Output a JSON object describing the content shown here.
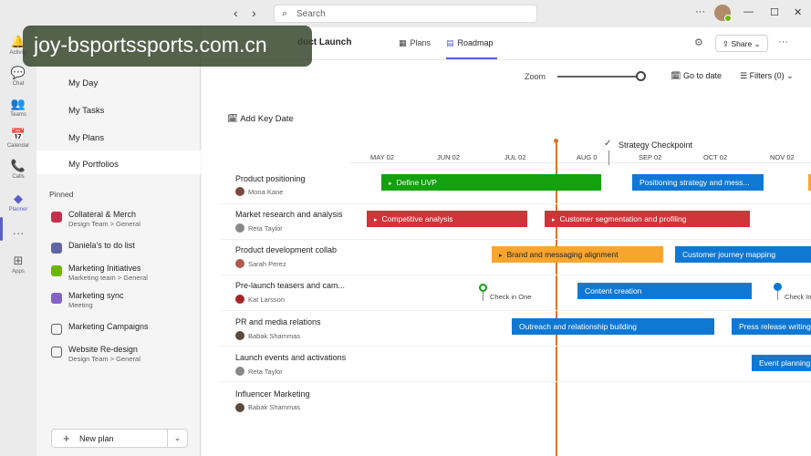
{
  "colors": {
    "green": "#13a10e",
    "red": "#d13438",
    "orange": "#f7a52f",
    "blue": "#0f78d4",
    "accent": "#5b5fc7",
    "today": "#d9722c"
  },
  "topbar": {
    "search_placeholder": "Search",
    "ellipsis": "···",
    "minimize": "—",
    "maximize": "☐",
    "close": "✕"
  },
  "watermark": "joy-bsportssports.com.cn",
  "rail": [
    {
      "label": "Activity",
      "icon": "bell-icon"
    },
    {
      "label": "Chat",
      "icon": "chat-icon"
    },
    {
      "label": "Teams",
      "icon": "teams-icon"
    },
    {
      "label": "Calendar",
      "icon": "calendar-icon"
    },
    {
      "label": "Calls",
      "icon": "phone-icon"
    },
    {
      "label": "Planner",
      "icon": "planner-icon"
    },
    {
      "label": "···",
      "icon": "more-icon"
    },
    {
      "label": "Apps",
      "icon": "apps-icon"
    }
  ],
  "leftnav": {
    "items": [
      "My Day",
      "My Tasks",
      "My Plans",
      "My Portfolios"
    ],
    "pinned_label": "Pinned"
  },
  "plans": [
    {
      "title": "Collateral & Merch",
      "subtitle": "Design Team > General",
      "color": "#c4314b"
    },
    {
      "title": "Daniela's to do list",
      "subtitle": "",
      "color": "#6264a7"
    },
    {
      "title": "Marketing Initiatives",
      "subtitle": "Marketing team > General",
      "color": "#6bb700"
    },
    {
      "title": "Marketing sync",
      "subtitle": "Meeting",
      "color": "#8661c5"
    },
    {
      "title": "Marketing Campaigns",
      "subtitle": "",
      "color": "#616161"
    },
    {
      "title": "Website Re-design",
      "subtitle": "Design Team > General",
      "color": "#616161"
    }
  ],
  "new_plan_label": "New plan",
  "header": {
    "plan_title": "duct Launch",
    "tabs": [
      "Plans",
      "Roadmap"
    ],
    "active_tab": "Roadmap",
    "share_label": "Share"
  },
  "toolbar": {
    "zoom_label": "Zoom",
    "zoom_fraction": 0.92,
    "goto_label": "Go to date",
    "filters_label": "Filters (0)"
  },
  "add_key_date": "Add Key Date",
  "milestone": {
    "label": "Strategy Checkpoint"
  },
  "months": [
    "MAY 02",
    "JUN 02",
    "JUL 02",
    "AUG 0",
    "SEP 02",
    "OCT 02",
    "NOV 02"
  ],
  "rows": [
    {
      "title": "Product positioning",
      "owner": "Mona Kane",
      "bars": [
        {
          "label": "Define UVP",
          "color": "green"
        },
        {
          "label": "Positioning strategy and mess...",
          "color": "blue"
        }
      ]
    },
    {
      "title": "Market research and analysis",
      "owner": "Reta Taylor",
      "bars": [
        {
          "label": "Competitive analysis",
          "color": "red"
        },
        {
          "label": "Customer segmentation and profiling",
          "color": "red"
        }
      ]
    },
    {
      "title": "Product development collab",
      "owner": "Sarah Perez",
      "bars": [
        {
          "label": "Brand and messaging alignment",
          "color": "orange"
        },
        {
          "label": "Customer journey mapping",
          "color": "blue"
        }
      ]
    },
    {
      "title": "Pre-launch teasers and cam...",
      "owner": "Kat Larsson",
      "bars": [
        {
          "label": "Content creation",
          "color": "blue"
        }
      ],
      "checkins": [
        "Check in One",
        "Check In"
      ]
    },
    {
      "title": "PR and media relations",
      "owner": "Babak Shammas",
      "bars": [
        {
          "label": "Outreach and relationship building",
          "color": "blue"
        },
        {
          "label": "Press release writing",
          "color": "blue"
        }
      ]
    },
    {
      "title": "Launch events and activations",
      "owner": "Reta Taylor",
      "bars": [
        {
          "label": "Event planning",
          "color": "blue"
        }
      ]
    },
    {
      "title": "Influencer Marketing",
      "owner": "Babak Shammas",
      "bars": []
    }
  ]
}
